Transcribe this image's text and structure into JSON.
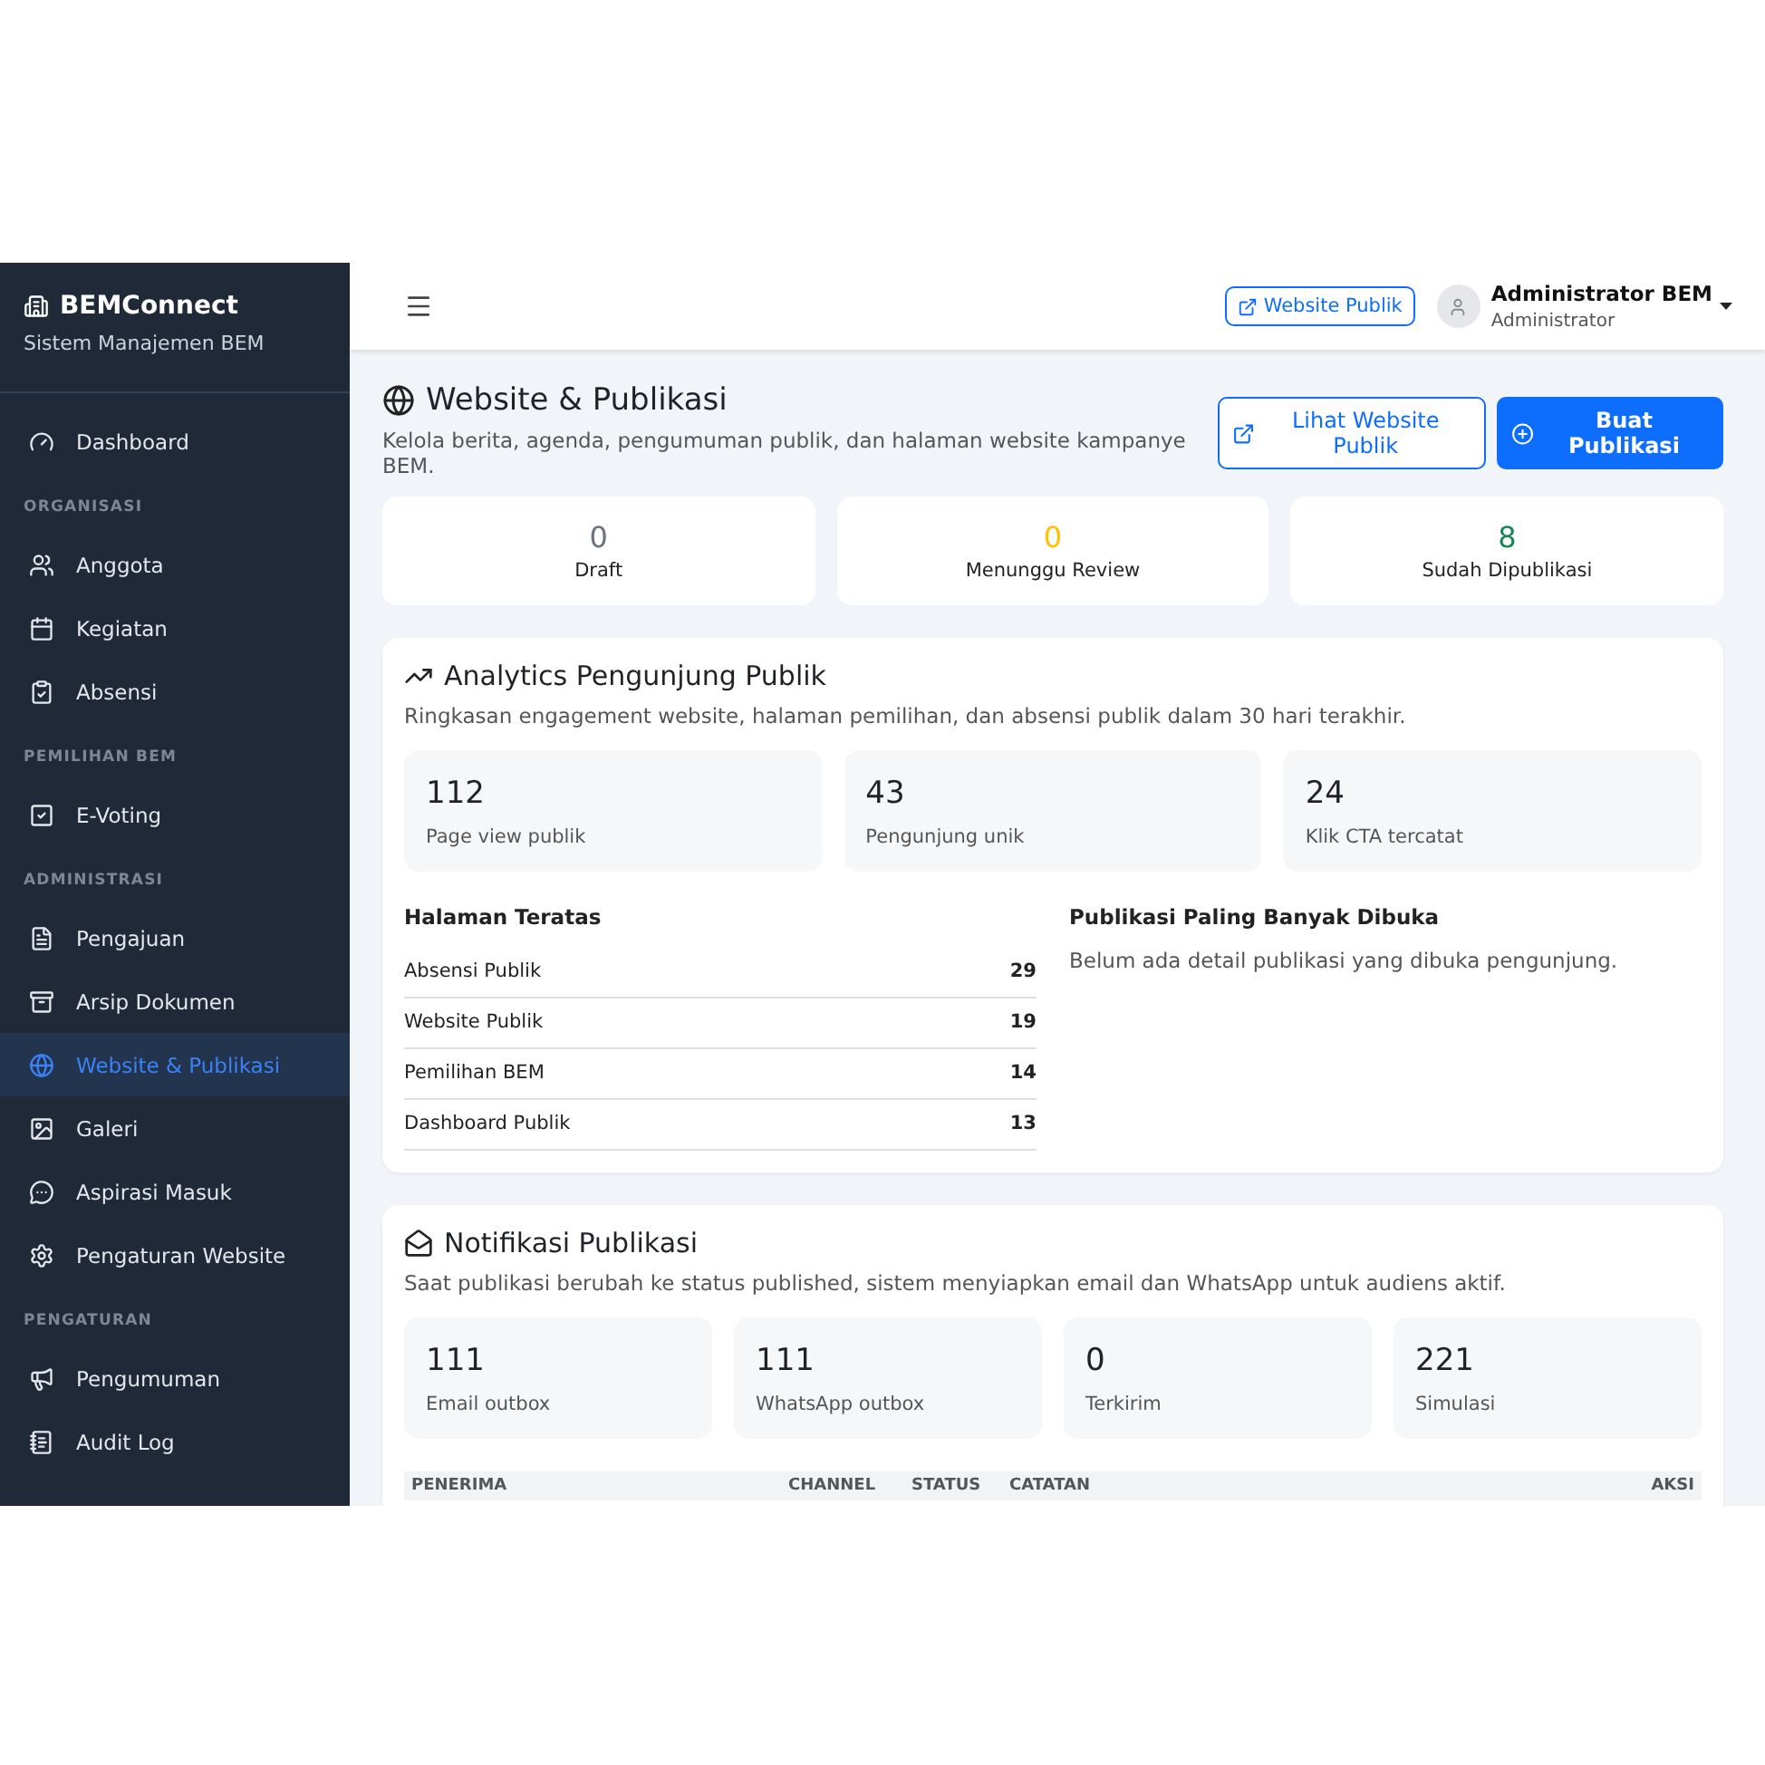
{
  "sidebar": {
    "brand": "BEMConnect",
    "subtitle": "Sistem Manajemen BEM",
    "items": [
      {
        "kind": "link",
        "label": "Dashboard",
        "selected": false
      },
      {
        "kind": "section",
        "label": "ORGANISASI"
      },
      {
        "kind": "link",
        "label": "Anggota",
        "selected": false
      },
      {
        "kind": "link",
        "label": "Kegiatan",
        "selected": false
      },
      {
        "kind": "link",
        "label": "Absensi",
        "selected": false
      },
      {
        "kind": "section",
        "label": "PEMILIHAN BEM"
      },
      {
        "kind": "link",
        "label": "E-Voting",
        "selected": false
      },
      {
        "kind": "section",
        "label": "ADMINISTRASI"
      },
      {
        "kind": "link",
        "label": "Pengajuan",
        "selected": false
      },
      {
        "kind": "link",
        "label": "Arsip Dokumen",
        "selected": false
      },
      {
        "kind": "link",
        "label": "Website & Publikasi",
        "selected": true
      },
      {
        "kind": "link",
        "label": "Galeri",
        "selected": false
      },
      {
        "kind": "link",
        "label": "Aspirasi Masuk",
        "selected": false
      },
      {
        "kind": "link",
        "label": "Pengaturan Website",
        "selected": false
      },
      {
        "kind": "section",
        "label": "PENGATURAN"
      },
      {
        "kind": "link",
        "label": "Pengumuman",
        "selected": false
      },
      {
        "kind": "link",
        "label": "Audit Log",
        "selected": false
      }
    ]
  },
  "topbar": {
    "website_button": "Website Publik",
    "user_name": "Administrator BEM",
    "user_role": "Administrator"
  },
  "page": {
    "title": "Website & Publikasi",
    "subtitle": "Kelola berita, agenda, pengumuman publik, dan halaman website kampanye BEM.",
    "buttons": [
      {
        "label": "Lihat Website Publik",
        "kind": "outline"
      },
      {
        "label": "Buat Publikasi",
        "kind": "primary"
      }
    ]
  },
  "status_stats": [
    {
      "value": "0",
      "label": "Draft",
      "color": "#6c757d"
    },
    {
      "value": "0",
      "label": "Menunggu Review",
      "color": "#ffc107"
    },
    {
      "value": "8",
      "label": "Sudah Dipublikasi",
      "color": "#198754"
    }
  ],
  "analytics": {
    "title": "Analytics Pengunjung Publik",
    "subtitle": "Ringkasan engagement website, halaman pemilihan, dan absensi publik dalam 30 hari terakhir.",
    "stats": [
      {
        "value": "112",
        "label": "Page view publik"
      },
      {
        "value": "43",
        "label": "Pengunjung unik"
      },
      {
        "value": "24",
        "label": "Klik CTA tercatat"
      }
    ],
    "top_pages": {
      "title": "Halaman Teratas",
      "rows": [
        {
          "name": "Absensi Publik",
          "count": "29"
        },
        {
          "name": "Website Publik",
          "count": "19"
        },
        {
          "name": "Pemilihan BEM",
          "count": "14"
        },
        {
          "name": "Dashboard Publik",
          "count": "13"
        }
      ]
    },
    "most_opened": {
      "title": "Publikasi Paling Banyak Dibuka",
      "empty": "Belum ada detail publikasi yang dibuka pengunjung."
    }
  },
  "notifications": {
    "title": "Notifikasi Publikasi",
    "subtitle": "Saat publikasi berubah ke status published, sistem menyiapkan email dan WhatsApp untuk audiens aktif.",
    "stats": [
      {
        "value": "111",
        "label": "Email outbox"
      },
      {
        "value": "111",
        "label": "WhatsApp outbox"
      },
      {
        "value": "0",
        "label": "Terkirim"
      },
      {
        "value": "221",
        "label": "Simulasi"
      }
    ],
    "table": {
      "columns": [
        "PENERIMA",
        "CHANNEL",
        "STATUS",
        "CATATAN",
        "AKSI"
      ]
    }
  }
}
